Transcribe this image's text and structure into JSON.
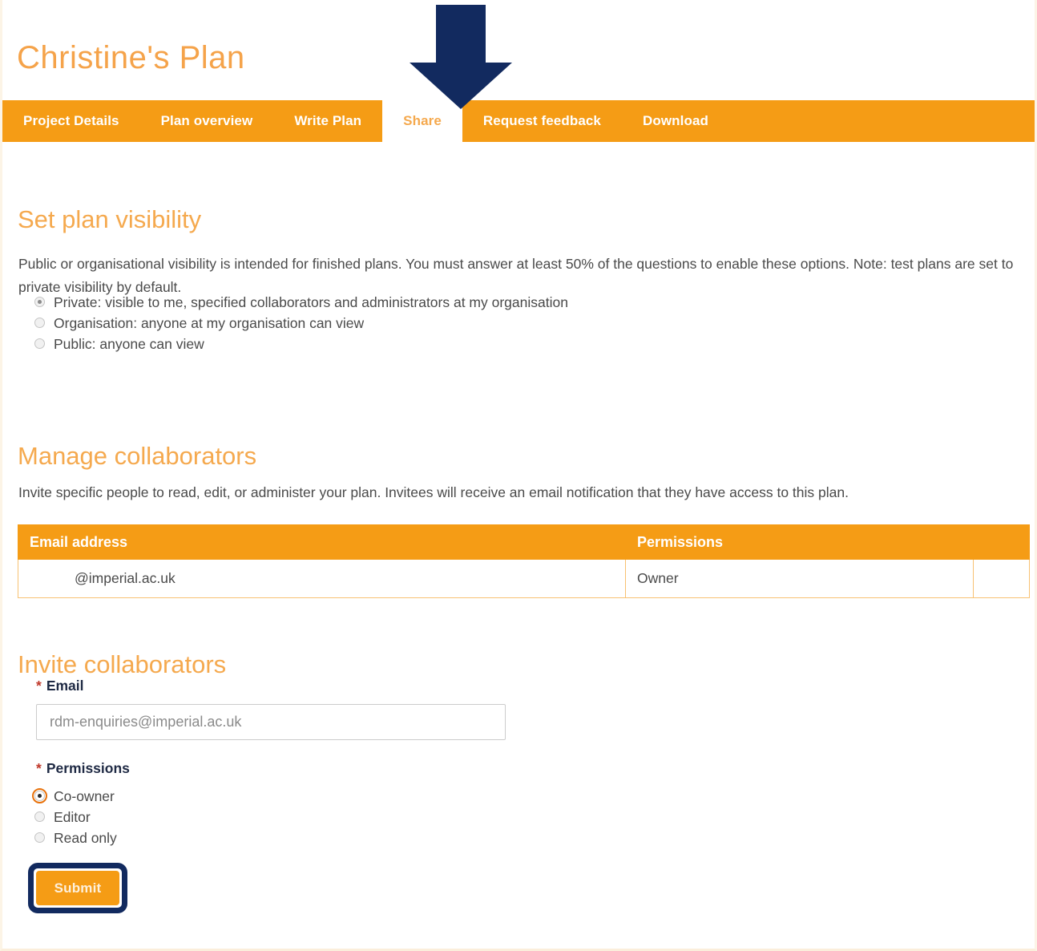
{
  "page": {
    "plan_title": "Christine's Plan",
    "accent_orange": "#f59c15",
    "heading_orange": "#f5a94e",
    "annotation_navy": "#122a5f"
  },
  "tabs": [
    {
      "label": "Project Details",
      "active": false
    },
    {
      "label": "Plan overview",
      "active": false
    },
    {
      "label": "Write Plan",
      "active": false
    },
    {
      "label": "Share",
      "active": true
    },
    {
      "label": "Request feedback",
      "active": false
    },
    {
      "label": "Download",
      "active": false
    }
  ],
  "annotations": {
    "arrow_icon": "down-arrow-icon",
    "arrow_target": "Share",
    "submit_highlight": "rounded-rectangle-outline"
  },
  "visibility": {
    "heading": "Set plan visibility",
    "description": "Public or organisational visibility is intended for finished plans. You must answer at least 50% of the questions to enable these options. Note: test plans are set to private visibility by default.",
    "options": [
      {
        "label": "Private: visible to me, specified collaborators and administrators at my organisation",
        "selected": true,
        "disabled": true
      },
      {
        "label": "Organisation: anyone at my organisation can view",
        "selected": false,
        "disabled": true
      },
      {
        "label": "Public: anyone can view",
        "selected": false,
        "disabled": true
      }
    ]
  },
  "manage_collaborators": {
    "heading": "Manage collaborators",
    "description": "Invite specific people to read, edit, or administer your plan. Invitees will receive an email notification that they have access to this plan.",
    "table": {
      "columns": [
        "Email address",
        "Permissions",
        ""
      ],
      "rows": [
        {
          "email": "@imperial.ac.uk",
          "permissions": "Owner",
          "actions": ""
        }
      ]
    }
  },
  "invite_collaborators": {
    "heading": "Invite collaborators",
    "email_label": "Email",
    "email_required_mark": "*",
    "email_value": "rdm-enquiries@imperial.ac.uk",
    "email_placeholder": "rdm-enquiries@imperial.ac.uk",
    "permissions_label": "Permissions",
    "permissions_required_mark": "*",
    "permissions_options": [
      {
        "label": "Co-owner",
        "selected": true,
        "focused": true
      },
      {
        "label": "Editor",
        "selected": false,
        "focused": false
      },
      {
        "label": "Read only",
        "selected": false,
        "focused": false
      }
    ],
    "submit_label": "Submit"
  }
}
